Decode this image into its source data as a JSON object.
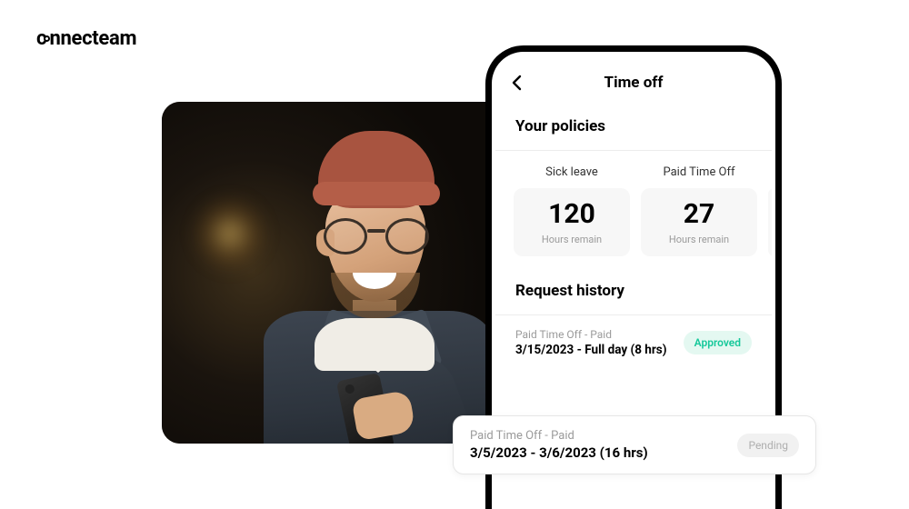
{
  "brand": {
    "name": "connecteam"
  },
  "app": {
    "screen_title": "Time off",
    "policies_heading": "Your policies",
    "policies": [
      {
        "name": "Sick leave",
        "value": "120",
        "sub": "Hours remain"
      },
      {
        "name": "Paid Time Off",
        "value": "27",
        "sub": "Hours remain"
      }
    ],
    "history_heading": "Request history",
    "history": [
      {
        "type": "Paid Time Off - Paid",
        "range": "3/15/2023 - Full day (8 hrs)",
        "status": "Approved"
      }
    ]
  },
  "floating_request": {
    "type": "Paid Time Off - Paid",
    "range": "3/5/2023 - 3/6/2023 (16 hrs)",
    "status": "Pending"
  }
}
